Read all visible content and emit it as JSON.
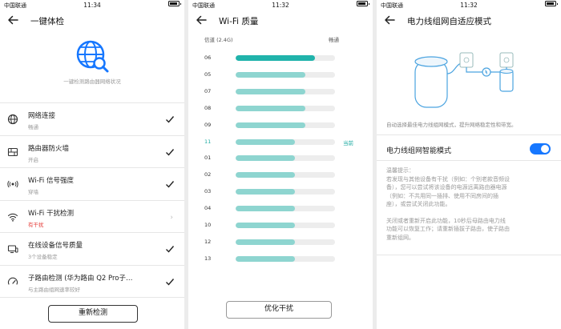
{
  "status_bars": [
    {
      "carrier": "中国联通",
      "time": "11:34",
      "battery": "100%"
    },
    {
      "carrier": "中国联通",
      "time": "11:32",
      "battery": "100%"
    },
    {
      "carrier": "中国联通",
      "time": "11:32",
      "battery": "100%"
    }
  ],
  "screen1": {
    "title": "一键体检",
    "hero_text": "一键检测路由器网络状况",
    "items": [
      {
        "icon": "globe-icon",
        "title": "网络连接",
        "subtitle": "畅通",
        "state": "ok"
      },
      {
        "icon": "firewall-icon",
        "title": "路由器防火墙",
        "subtitle": "开启",
        "state": "ok"
      },
      {
        "icon": "signal-strength-icon",
        "title": "Wi-Fi 信号强度",
        "subtitle": "穿墙",
        "state": "ok"
      },
      {
        "icon": "wifi-icon",
        "title": "Wi-Fi 干扰检测",
        "subtitle": "有干扰",
        "state": "warn"
      },
      {
        "icon": "device-icon",
        "title": "在线设备信号质量",
        "subtitle": "3个设备稳定",
        "state": "ok"
      },
      {
        "icon": "speed-gauge-icon",
        "title": "子路由检测 (华为路由 Q2 Pro子…",
        "subtitle": "与主路由组网速率较好",
        "state": "ok"
      }
    ],
    "button": "重新检测"
  },
  "screen2": {
    "title": "Wi-Fi 质量",
    "header_left": "信道 (2.4G)",
    "header_right": "畅通",
    "current_tag": "当前",
    "channels": [
      {
        "ch": "06",
        "quality": 0.8,
        "best": true
      },
      {
        "ch": "05",
        "quality": 0.7
      },
      {
        "ch": "07",
        "quality": 0.7
      },
      {
        "ch": "08",
        "quality": 0.7
      },
      {
        "ch": "09",
        "quality": 0.7
      },
      {
        "ch": "11",
        "quality": 0.6,
        "current": true
      },
      {
        "ch": "01",
        "quality": 0.6
      },
      {
        "ch": "02",
        "quality": 0.6
      },
      {
        "ch": "03",
        "quality": 0.6
      },
      {
        "ch": "04",
        "quality": 0.6
      },
      {
        "ch": "10",
        "quality": 0.6
      },
      {
        "ch": "12",
        "quality": 0.6
      },
      {
        "ch": "13",
        "quality": 0.6
      }
    ],
    "button": "优化干扰"
  },
  "screen3": {
    "title": "电力线组网自适应模式",
    "description": "自动选择最佳电力线组网模式，提升网络稳定性和带宽。",
    "toggle_label": "电力线组网智能模式",
    "toggle_on": true,
    "tips": [
      "温馨提示：",
      "若发现与其他设备有干扰（例如：个别老款音频设",
      "备），您可以尝试将该设备的电源远离路由器电源",
      "（例如：不共用同一插排、使用不同房间的插",
      "座），或尝试关闭此功能。",
      "",
      "关闭或者重新开启此功能，10秒后母路由电力线",
      "功能可以恢复工作；请重新插拔子路由，使子路由",
      "重新组网。"
    ]
  },
  "colors": {
    "accent": "#1677ff",
    "teal": "#20b3ab",
    "teal_light": "#8ed5d0",
    "warn": "#e53935"
  }
}
